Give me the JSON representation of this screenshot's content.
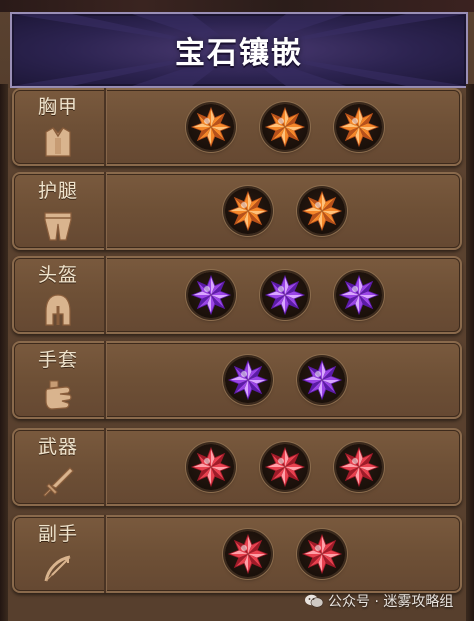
{
  "title": "宝石镶嵌",
  "rows": [
    {
      "label": "胸甲",
      "slot_icon": "chest-armor-icon",
      "gem_color": "orange",
      "gem_count": 3
    },
    {
      "label": "护腿",
      "slot_icon": "leg-armor-icon",
      "gem_color": "orange",
      "gem_count": 2
    },
    {
      "label": "头盔",
      "slot_icon": "helmet-icon",
      "gem_color": "purple",
      "gem_count": 3
    },
    {
      "label": "手套",
      "slot_icon": "glove-icon",
      "gem_color": "purple",
      "gem_count": 2
    },
    {
      "label": "武器",
      "slot_icon": "sword-icon",
      "gem_color": "red",
      "gem_count": 3
    },
    {
      "label": "副手",
      "slot_icon": "bow-icon",
      "gem_color": "red",
      "gem_count": 2
    }
  ],
  "gem_colors": {
    "orange": {
      "light": "#ffc27a",
      "mid": "#f5872a",
      "dark": "#b8501a"
    },
    "purple": {
      "light": "#d9a6ff",
      "mid": "#9a45e6",
      "dark": "#5b1aa8"
    },
    "red": {
      "light": "#ffa0a8",
      "mid": "#e8414f",
      "dark": "#a01a28"
    }
  },
  "watermark": "公众号 · 迷雾攻略组"
}
